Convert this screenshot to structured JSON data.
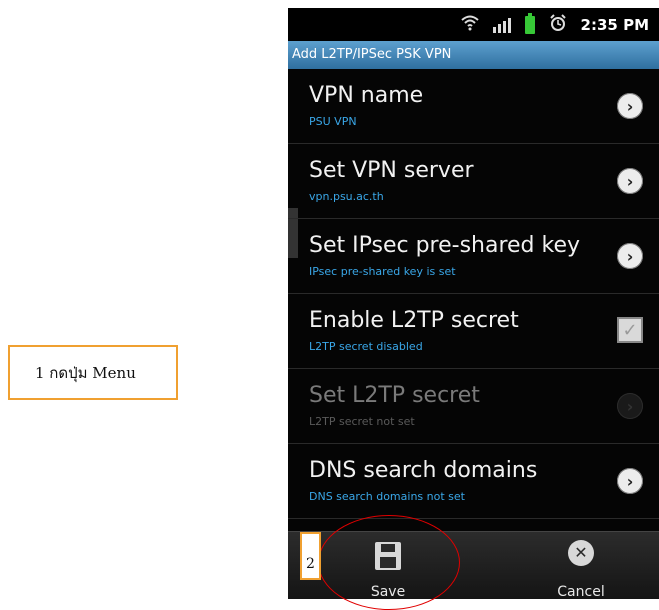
{
  "annotation_1": "1 กดปุ่ม Menu",
  "annotation_2": "2",
  "statusbar": {
    "time": "2:35 PM"
  },
  "title": "Add L2TP/IPSec PSK VPN",
  "rows": [
    {
      "title": "VPN name",
      "sub": "PSU VPN"
    },
    {
      "title": "Set VPN server",
      "sub": "vpn.psu.ac.th"
    },
    {
      "title": "Set IPsec pre-shared key",
      "sub": "IPsec pre-shared key is set"
    },
    {
      "title": "Enable L2TP secret",
      "sub": "L2TP secret disabled"
    },
    {
      "title": "Set L2TP secret",
      "sub": "L2TP secret not set"
    },
    {
      "title": "DNS search domains",
      "sub": "DNS search domains not set"
    }
  ],
  "bottombar": {
    "save": "Save",
    "cancel": "Cancel"
  }
}
